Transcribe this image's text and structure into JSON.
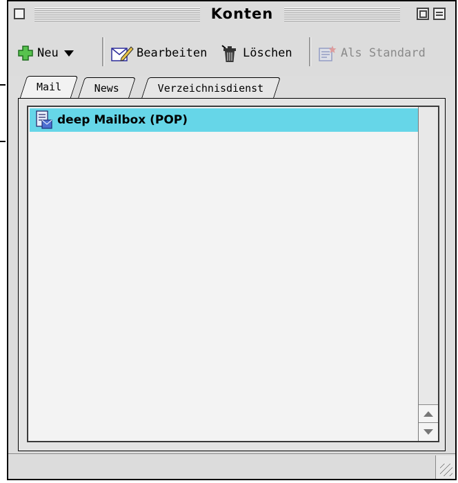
{
  "window": {
    "title": "Konten"
  },
  "toolbar": {
    "new_label": "Neu",
    "edit_label": "Bearbeiten",
    "delete_label": "Löschen",
    "default_label": "Als Standard",
    "icons": {
      "new": "plus-icon",
      "new_menu": "triangle-down-icon",
      "edit": "edit-document-icon",
      "delete": "trash-icon",
      "default": "default-account-icon"
    }
  },
  "tabs": [
    {
      "label": "Mail",
      "active": true
    },
    {
      "label": "News",
      "active": false
    },
    {
      "label": "Verzeichnisdienst",
      "active": false
    }
  ],
  "accounts": [
    {
      "label": "deep Mailbox (POP)",
      "icon": "mailbox-icon",
      "selected": true
    }
  ],
  "colors": {
    "selection": "#66d6e8",
    "window_bg": "#dddddd",
    "list_bg": "#f3f3f3",
    "new_icon": "#3aa23a"
  }
}
